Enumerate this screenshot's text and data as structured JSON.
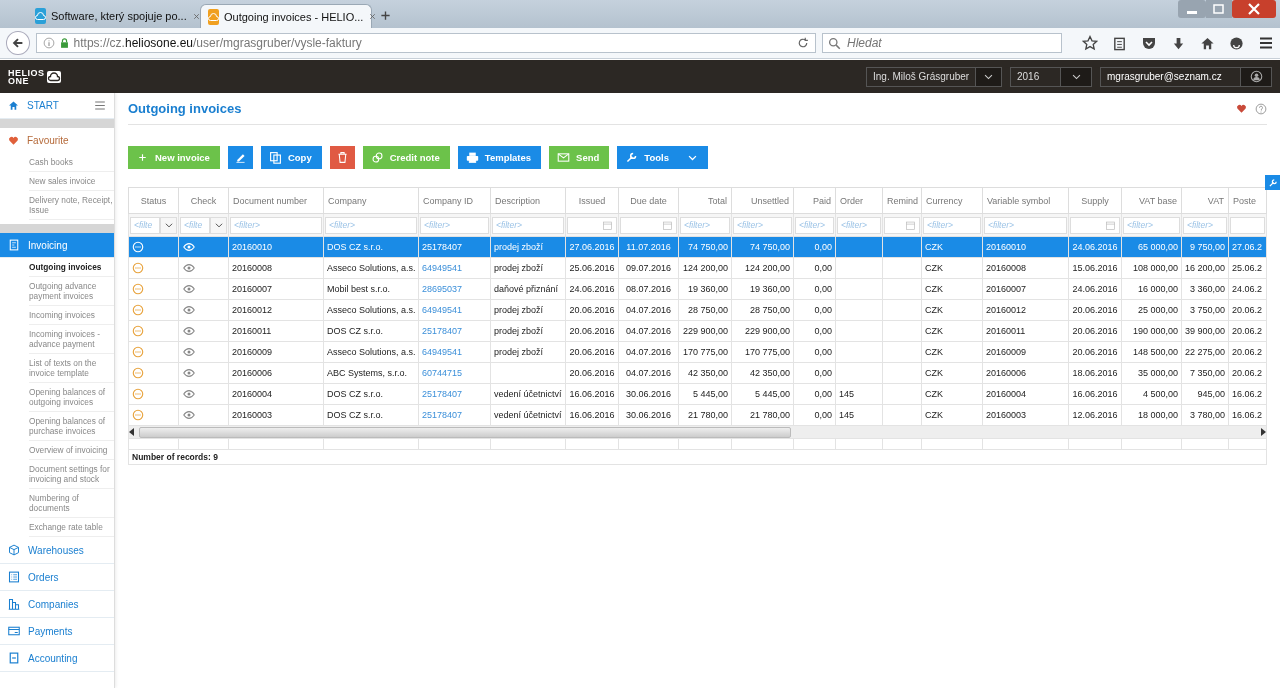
{
  "browser": {
    "tabs": [
      {
        "title": "Software, který spojuje po...",
        "selected": false
      },
      {
        "title": "Outgoing invoices - HELIO...",
        "selected": true
      }
    ],
    "url": "https://cz.**heliosone.eu**/user/mgrasgruber/vysle-faktury",
    "search": {
      "placeholder": "Hledat"
    }
  },
  "header": {
    "logo": {
      "line1": "HELIOS",
      "line2": "ONE"
    },
    "user": "Ing. Miloš Grásgruber",
    "year": "2016",
    "email": "mgrasgruber@seznam.cz"
  },
  "sidebar": {
    "start": "START",
    "favourite": {
      "label": "Favourite",
      "items": [
        "Cash books",
        "New sales invoice",
        "Delivery note, Receipt, Issue"
      ]
    },
    "sections": [
      {
        "label": "Invoicing",
        "selected": true,
        "children": [
          {
            "label": "Outgoing invoices",
            "selected": true
          },
          {
            "label": "Outgoing advance payment invoices",
            "selected": false
          },
          {
            "label": "Incoming invoices",
            "selected": false
          },
          {
            "label": "Incoming invoices - advance payment",
            "selected": false
          },
          {
            "label": "List of texts on the invoice template",
            "selected": false
          },
          {
            "label": "Opening balances of outgoing invoices",
            "selected": false
          },
          {
            "label": "Opening balances of purchase invoices",
            "selected": false
          },
          {
            "label": "Overview of invoicing",
            "selected": false
          },
          {
            "label": "Document settings for invoicing and stock",
            "selected": false
          },
          {
            "label": "Numbering of documents",
            "selected": false
          },
          {
            "label": "Exchange rate table",
            "selected": false
          }
        ]
      },
      {
        "label": "Warehouses",
        "selected": false
      },
      {
        "label": "Orders",
        "selected": false
      },
      {
        "label": "Companies",
        "selected": false
      },
      {
        "label": "Payments",
        "selected": false
      },
      {
        "label": "Accounting",
        "selected": false
      }
    ]
  },
  "page": {
    "title": "Outgoing invoices"
  },
  "toolbar": [
    {
      "label": "New invoice",
      "color": "#6cc24a"
    },
    {
      "color": "#1a8be6"
    },
    {
      "label": "Copy",
      "color": "#1a8be6"
    },
    {
      "color": "#e05a43"
    },
    {
      "label": "Credit note",
      "color": "#6cc24a"
    },
    {
      "label": "Templates",
      "color": "#1a8be6"
    },
    {
      "label": "Send",
      "color": "#6cc24a"
    },
    {
      "label": "Tools",
      "color": "#1a8be6",
      "dropdown": true
    }
  ],
  "table": {
    "columns": [
      {
        "label": "Status",
        "kind": "select",
        "placeholder": "<filte"
      },
      {
        "label": "Check",
        "kind": "select",
        "placeholder": "<filte"
      },
      {
        "label": "Document number",
        "kind": "text",
        "placeholder": "<filter>"
      },
      {
        "label": "Company",
        "kind": "text",
        "placeholder": "<filter>"
      },
      {
        "label": "Company ID",
        "kind": "text",
        "placeholder": "<filter>"
      },
      {
        "label": "Description",
        "kind": "text",
        "placeholder": "<filter>"
      },
      {
        "label": "Issued",
        "kind": "date"
      },
      {
        "label": "Due date",
        "kind": "date"
      },
      {
        "label": "Total",
        "kind": "text",
        "placeholder": "<filter>"
      },
      {
        "label": "Unsettled",
        "kind": "text",
        "placeholder": "<filter>"
      },
      {
        "label": "Paid",
        "kind": "text",
        "placeholder": "<filter>"
      },
      {
        "label": "Order",
        "kind": "text",
        "placeholder": "<filter>"
      },
      {
        "label": "Remind",
        "kind": "date"
      },
      {
        "label": "Currency",
        "kind": "text",
        "placeholder": "<filter>"
      },
      {
        "label": "Variable symbol",
        "kind": "text",
        "placeholder": "<filter>"
      },
      {
        "label": "Supply",
        "kind": "date"
      },
      {
        "label": "VAT base",
        "kind": "text",
        "placeholder": "<filter>"
      },
      {
        "label": "VAT",
        "kind": "text",
        "placeholder": "<filter>"
      },
      {
        "label": "Poste",
        "kind": "blank"
      }
    ],
    "rows": [
      {
        "selected": true,
        "document_number": "20160010",
        "company": "DOS CZ s.r.o.",
        "company_id": "25178407",
        "description": "prodej zboží",
        "issued": "27.06.2016",
        "due_date": "11.07.2016",
        "total": "74 750,00",
        "unsettled": "74 750,00",
        "paid": "0,00",
        "currency": "CZK",
        "variable_symbol": "20160010",
        "supply": "24.06.2016",
        "vat_base": "65 000,00",
        "vat": "9 750,00",
        "posted": "27.06.2"
      },
      {
        "selected": false,
        "document_number": "20160008",
        "company": "Asseco Solutions, a.s.",
        "company_id": "64949541",
        "description": "prodej zboží",
        "issued": "25.06.2016",
        "due_date": "09.07.2016",
        "total": "124 200,00",
        "unsettled": "124 200,00",
        "paid": "0,00",
        "currency": "CZK",
        "variable_symbol": "20160008",
        "supply": "15.06.2016",
        "vat_base": "108 000,00",
        "vat": "16 200,00",
        "posted": "25.06.2"
      },
      {
        "selected": false,
        "document_number": "20160007",
        "company": "Mobil best s.r.o.",
        "company_id": "28695037",
        "description": "daňové přiznání",
        "issued": "24.06.2016",
        "due_date": "08.07.2016",
        "total": "19 360,00",
        "unsettled": "19 360,00",
        "paid": "0,00",
        "currency": "CZK",
        "variable_symbol": "20160007",
        "supply": "24.06.2016",
        "vat_base": "16 000,00",
        "vat": "3 360,00",
        "posted": "24.06.2"
      },
      {
        "selected": false,
        "document_number": "20160012",
        "company": "Asseco Solutions, a.s.",
        "company_id": "64949541",
        "description": "prodej zboží",
        "issued": "20.06.2016",
        "due_date": "04.07.2016",
        "total": "28 750,00",
        "unsettled": "28 750,00",
        "paid": "0,00",
        "currency": "CZK",
        "variable_symbol": "20160012",
        "supply": "20.06.2016",
        "vat_base": "25 000,00",
        "vat": "3 750,00",
        "posted": "20.06.2"
      },
      {
        "selected": false,
        "document_number": "20160011",
        "company": "DOS CZ s.r.o.",
        "company_id": "25178407",
        "description": "prodej zboží",
        "issued": "20.06.2016",
        "due_date": "04.07.2016",
        "total": "229 900,00",
        "unsettled": "229 900,00",
        "paid": "0,00",
        "currency": "CZK",
        "variable_symbol": "20160011",
        "supply": "20.06.2016",
        "vat_base": "190 000,00",
        "vat": "39 900,00",
        "posted": "20.06.2"
      },
      {
        "selected": false,
        "document_number": "20160009",
        "company": "Asseco Solutions, a.s.",
        "company_id": "64949541",
        "description": "prodej zboží",
        "issued": "20.06.2016",
        "due_date": "04.07.2016",
        "total": "170 775,00",
        "unsettled": "170 775,00",
        "paid": "0,00",
        "currency": "CZK",
        "variable_symbol": "20160009",
        "supply": "20.06.2016",
        "vat_base": "148 500,00",
        "vat": "22 275,00",
        "posted": "20.06.2"
      },
      {
        "selected": false,
        "document_number": "20160006",
        "company": "ABC Systems, s.r.o.",
        "company_id": "60744715",
        "issued": "20.06.2016",
        "due_date": "04.07.2016",
        "total": "42 350,00",
        "unsettled": "42 350,00",
        "paid": "0,00",
        "currency": "CZK",
        "variable_symbol": "20160006",
        "supply": "18.06.2016",
        "vat_base": "35 000,00",
        "vat": "7 350,00",
        "posted": "20.06.2"
      },
      {
        "selected": false,
        "document_number": "20160004",
        "company": "DOS CZ s.r.o.",
        "company_id": "25178407",
        "description": "vedení účetnictví",
        "issued": "16.06.2016",
        "due_date": "30.06.2016",
        "total": "5 445,00",
        "unsettled": "5 445,00",
        "paid": "0,00",
        "order": "145",
        "currency": "CZK",
        "variable_symbol": "20160004",
        "supply": "16.06.2016",
        "vat_base": "4 500,00",
        "vat": "945,00",
        "posted": "16.06.2"
      },
      {
        "selected": false,
        "document_number": "20160003",
        "company": "DOS CZ s.r.o.",
        "company_id": "25178407",
        "description": "vedení účetnictví",
        "issued": "16.06.2016",
        "due_date": "30.06.2016",
        "total": "21 780,00",
        "unsettled": "21 780,00",
        "paid": "0,00",
        "order": "145",
        "currency": "CZK",
        "variable_symbol": "20160003",
        "supply": "12.06.2016",
        "vat_base": "18 000,00",
        "vat": "3 780,00",
        "posted": "16.06.2"
      }
    ],
    "record_count": "Number of records: 9"
  }
}
